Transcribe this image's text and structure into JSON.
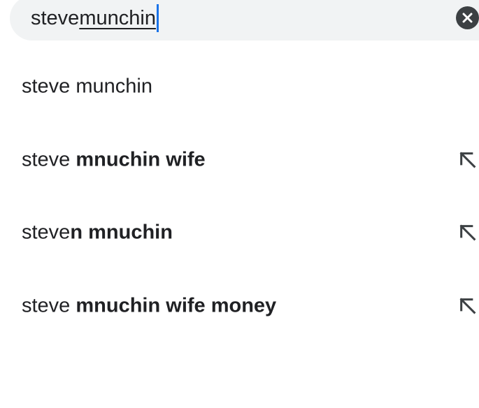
{
  "search": {
    "typed_prefix": "steve ",
    "composing_word": "munchin",
    "clear_icon": "close-circle-icon"
  },
  "suggestions": [
    {
      "plain_prefix": "steve munchin",
      "bold_suffix": "",
      "fill_icon": null
    },
    {
      "plain_prefix": "steve ",
      "bold_suffix": "mnuchin wife",
      "fill_icon": "arrow-up-left-icon"
    },
    {
      "plain_prefix": "steve",
      "bold_suffix": "n mnuchin",
      "fill_icon": "arrow-up-left-icon"
    },
    {
      "plain_prefix": "steve ",
      "bold_suffix": "mnuchin wife money",
      "fill_icon": "arrow-up-left-icon"
    }
  ],
  "colors": {
    "search_bg": "#f1f3f4",
    "caret": "#1a73e8",
    "text": "#202124",
    "icon": "#3c4043"
  }
}
